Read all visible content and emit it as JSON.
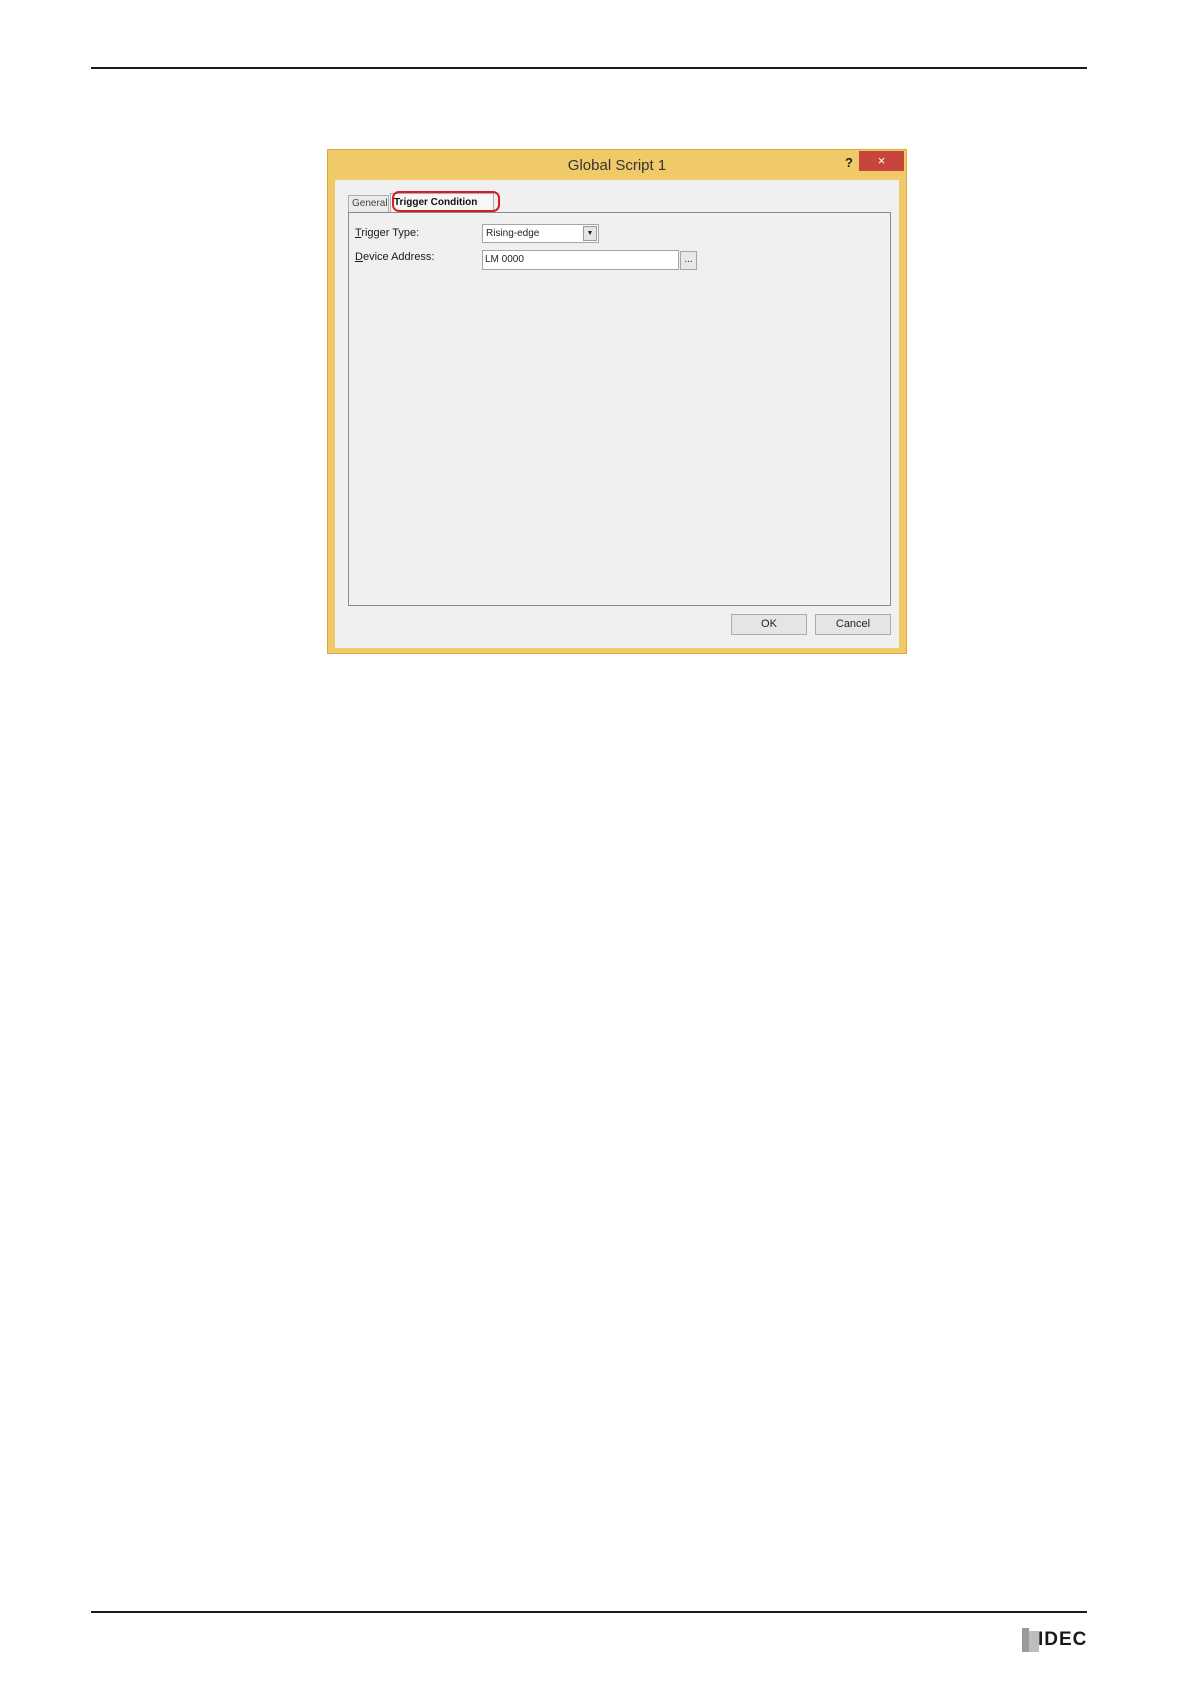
{
  "dialog": {
    "title": "Global Script 1",
    "help_label": "?",
    "close_label": "×",
    "tabs": [
      {
        "label": "General",
        "active": false
      },
      {
        "label": "Trigger Condition",
        "active": true
      }
    ],
    "trigger_type": {
      "label_mnemonic": "T",
      "label_rest": "rigger Type:",
      "value": "Rising-edge"
    },
    "device_address": {
      "label_mnemonic": "D",
      "label_rest": "evice Address:",
      "value": "LM 0000",
      "browse_label": "..."
    },
    "ok_label": "OK",
    "cancel_label": "Cancel"
  },
  "footer": {
    "logo_text": "IDEC"
  },
  "colors": {
    "titlebar": "#f0ca68",
    "close_button": "#c7453a",
    "highlight": "#d62020"
  }
}
